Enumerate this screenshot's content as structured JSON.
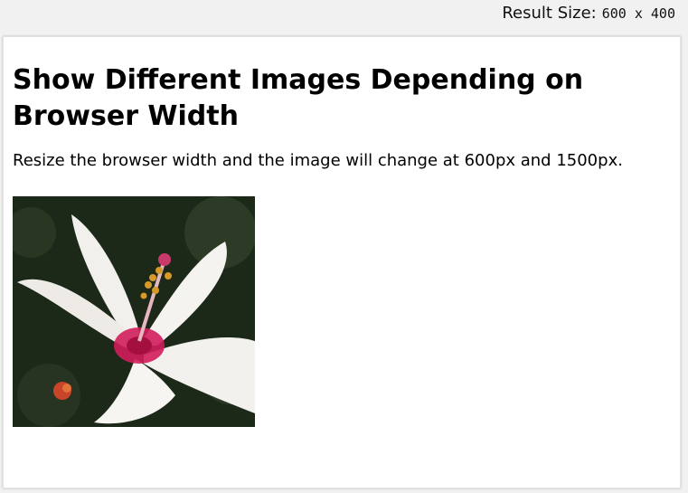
{
  "header": {
    "result_label": "Result Size:",
    "result_dims": "600 x 400"
  },
  "main": {
    "title": "Show Different Images Depending on Browser Width",
    "description": "Resize the browser width and the image will change at 600px and 1500px.",
    "image": {
      "icon": "flower-image",
      "colors": {
        "background": "#1d2a1a",
        "petal": "#f3f1ee",
        "center": "#d11d5c",
        "stamen": "#c98a2a"
      }
    }
  }
}
